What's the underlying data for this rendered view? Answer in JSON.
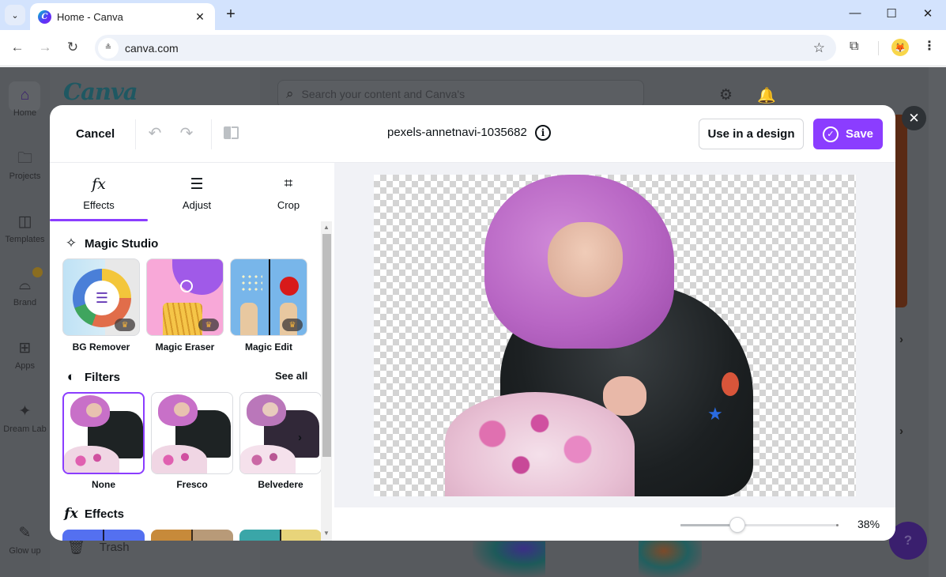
{
  "browser": {
    "tab_title": "Home - Canva",
    "tab_favicon": "canva-logo-icon",
    "url": "canva.com",
    "icons": {
      "tab_list": "⌄",
      "tab_close": "✕",
      "new_tab": "+",
      "minimize": "—",
      "maximize": "☐",
      "close": "✕",
      "back": "←",
      "forward": "→",
      "reload": "↻",
      "site_info": "⚙",
      "bookmark": "☆",
      "extensions": "⧉",
      "menu": "⋮"
    }
  },
  "canva_bg": {
    "logo": "Canva",
    "rail": [
      {
        "label": "Home",
        "icon": "⌂"
      },
      {
        "label": "Projects",
        "icon": "🗀"
      },
      {
        "label": "Templates",
        "icon": "◫"
      },
      {
        "label": "Brand",
        "icon": "⌓"
      },
      {
        "label": "Apps",
        "icon": "⊞"
      },
      {
        "label": "Dream Lab",
        "icon": "✦"
      },
      {
        "label": "Glow up",
        "icon": "✎"
      }
    ],
    "search_placeholder": "Search your content and Canva's",
    "trash_label": "Trash",
    "trash_icon": "🗑",
    "help_label": "?",
    "settings_icon": "⚙",
    "bell_icon": "🔔",
    "chevron": "›"
  },
  "editor": {
    "cancel_label": "Cancel",
    "undo_icon": "↶",
    "redo_icon": "↷",
    "file_name": "pexels-annetnavi-1035682",
    "info_icon": "i",
    "use_in_design_label": "Use in a design",
    "save_label": "Save",
    "save_icon": "✓",
    "close_icon": "✕",
    "tabs": [
      {
        "label": "Effects",
        "icon": "fx",
        "active": true
      },
      {
        "label": "Adjust",
        "icon": "☰"
      },
      {
        "label": "Crop",
        "icon": "⌗"
      }
    ],
    "magic_studio": {
      "title": "Magic Studio",
      "icon": "✧",
      "tools": [
        {
          "label": "BG Remover",
          "premium": true
        },
        {
          "label": "Magic Eraser",
          "premium": true
        },
        {
          "label": "Magic Edit",
          "premium": true
        }
      ],
      "crown_icon": "♛",
      "bg_remover_glyph": "☰"
    },
    "filters": {
      "title": "Filters",
      "icon": "◐",
      "see_all_label": "See all",
      "items": [
        {
          "label": "None",
          "selected": true
        },
        {
          "label": "Fresco",
          "selected": false
        },
        {
          "label": "Belvedere",
          "selected": false
        }
      ],
      "next_icon": "›"
    },
    "effects": {
      "title": "Effects",
      "icon": "fx"
    },
    "subject_star": "★",
    "zoom": {
      "percent_label": "38%",
      "value_fraction": 0.36
    },
    "scroll_up": "▲",
    "scroll_down": "▼"
  }
}
